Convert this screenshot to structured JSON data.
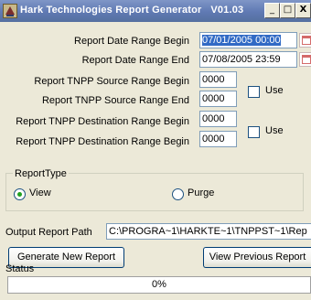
{
  "window": {
    "title": "Hark Technologies Report Generator",
    "version": "V01.03",
    "minimize_glyph": "_",
    "maximize_glyph": "□",
    "close_glyph": "X"
  },
  "form": {
    "date_begin": {
      "label": "Report Date Range Begin",
      "value": "07/01/2005 00:00"
    },
    "date_end": {
      "label": "Report Date Range End",
      "value": "07/08/2005 23:59"
    },
    "tnpp_source_begin": {
      "label": "Report TNPP Source Range Begin",
      "value": "0000"
    },
    "tnpp_source_end": {
      "label": "Report TNPP Source Range End",
      "value": "0000"
    },
    "tnpp_source_use": {
      "label": "Use",
      "checked": false
    },
    "tnpp_dest_begin": {
      "label": "Report TNPP Destination Range Begin",
      "value": "0000"
    },
    "tnpp_dest_end": {
      "label": "Report TNPP Destination Range Begin",
      "value": "0000"
    },
    "tnpp_dest_use": {
      "label": "Use",
      "checked": false
    }
  },
  "report_type": {
    "title": "ReportType",
    "options": [
      {
        "label": "View",
        "selected": true
      },
      {
        "label": "Purge",
        "selected": false
      }
    ]
  },
  "output": {
    "label": "Output Report Path",
    "value": "C:\\PROGRA~1\\HARKTE~1\\TNPPST~1\\Rep"
  },
  "buttons": {
    "generate": "Generate New Report",
    "view_previous": "View Previous Report"
  },
  "status": {
    "label": "Status",
    "progress": 0,
    "progress_text": "0%"
  },
  "colors": {
    "title_bar": "#5f79b3",
    "selection": "#316ac5",
    "radio_dot": "#21a121"
  }
}
